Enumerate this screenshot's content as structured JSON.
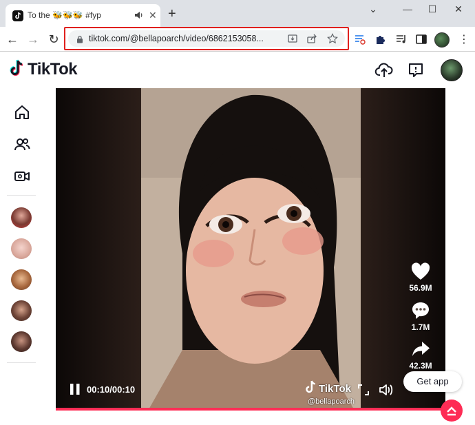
{
  "browser": {
    "tab": {
      "title": "To the 🐝🐝🐝 #fyp",
      "close_glyph": "✕"
    },
    "new_tab_glyph": "+",
    "window": {
      "chevron": "⌄",
      "minimize": "—",
      "maximize": "☐",
      "close": "✕"
    },
    "nav": {
      "back": "←",
      "forward": "→",
      "reload": "↻"
    },
    "url": "tiktok.com/@bellapoarch/video/6862153058...",
    "menu_glyph": "⋮"
  },
  "tiktok": {
    "logo_text": "TikTok",
    "video": {
      "time": "00:10/00:10",
      "watermark_logo": "TikTok",
      "watermark_handle": "@bellapoarch",
      "likes": "56.9M",
      "comments": "1.7M",
      "shares": "42.3M",
      "progress": 1.0
    },
    "get_app_label": "Get app"
  },
  "colors": {
    "accent": "#fe2c55",
    "highlight": "#e0201e",
    "tabstrip": "#dee1e6",
    "omnibox": "#f1f3f4"
  }
}
